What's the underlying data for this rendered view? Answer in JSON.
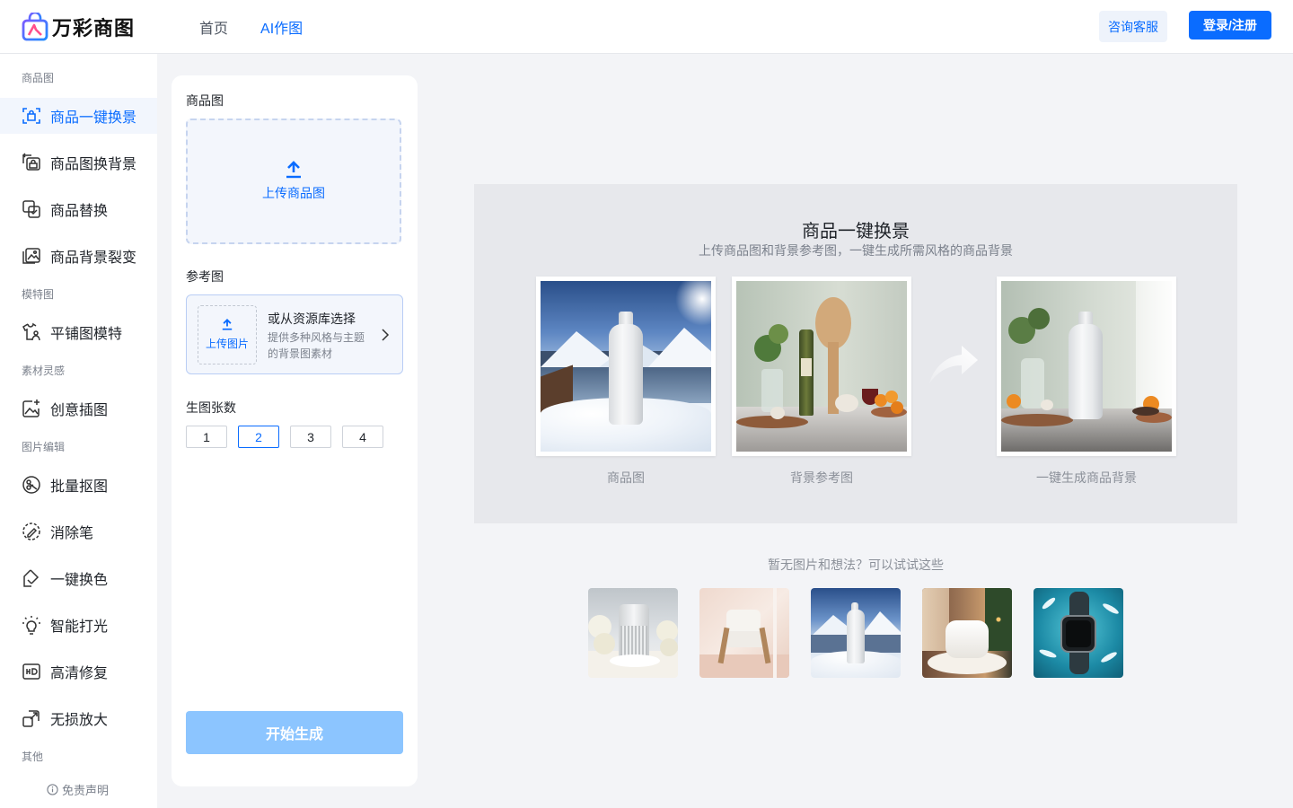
{
  "header": {
    "brand": "万彩商图",
    "nav": [
      {
        "label": "首页",
        "active": false
      },
      {
        "label": "AI作图",
        "active": true
      }
    ],
    "consult_label": "咨询客服",
    "login_label": "登录/注册",
    "accent_color": "#0a6cff"
  },
  "sidebar": {
    "groups": [
      {
        "label": "商品图",
        "items": [
          {
            "label": "商品一键换景",
            "icon": "scan-product-icon",
            "active": true
          },
          {
            "label": "商品图换背景",
            "icon": "image-swap-icon",
            "active": false
          },
          {
            "label": "商品替换",
            "icon": "product-replace-icon",
            "active": false
          },
          {
            "label": "商品背景裂变",
            "icon": "image-variants-icon",
            "active": false
          }
        ]
      },
      {
        "label": "模特图",
        "items": [
          {
            "label": "平铺图模特",
            "icon": "tshirt-model-icon",
            "active": false
          }
        ]
      },
      {
        "label": "素材灵感",
        "items": [
          {
            "label": "创意插图",
            "icon": "sparkle-image-icon",
            "active": false
          }
        ]
      },
      {
        "label": "图片编辑",
        "items": [
          {
            "label": "批量抠图",
            "icon": "cutout-icon",
            "active": false
          },
          {
            "label": "消除笔",
            "icon": "eraser-pen-icon",
            "active": false
          },
          {
            "label": "一键换色",
            "icon": "color-swap-icon",
            "active": false
          },
          {
            "label": "智能打光",
            "icon": "bulb-icon",
            "active": false
          },
          {
            "label": "高清修复",
            "icon": "hd-icon",
            "active": false
          },
          {
            "label": "无损放大",
            "icon": "expand-icon",
            "active": false
          }
        ]
      },
      {
        "label": "其他",
        "items": []
      }
    ],
    "disclaimer": "免责声明"
  },
  "panel": {
    "product_label": "商品图",
    "upload_product": "上传商品图",
    "reference_label": "参考图",
    "upload_image": "上传图片",
    "library_title": "或从资源库选择",
    "library_desc": "提供多种风格与主题的背景图素材",
    "count_label": "生图张数",
    "counts": [
      "1",
      "2",
      "3",
      "4"
    ],
    "selected_count": "2",
    "start_label": "开始生成"
  },
  "showcase": {
    "title": "商品一键换景",
    "subtitle": "上传商品图和背景参考图，一键生成所需风格的商品背景",
    "captions": [
      "商品图",
      "背景参考图",
      "一键生成商品背景"
    ]
  },
  "samples": {
    "title": "暂无图片和想法？可以试试这些",
    "items": [
      "speaker-with-roses",
      "armchair",
      "bottle-snow",
      "pillow-christmas",
      "smartwatch-feathers"
    ]
  }
}
